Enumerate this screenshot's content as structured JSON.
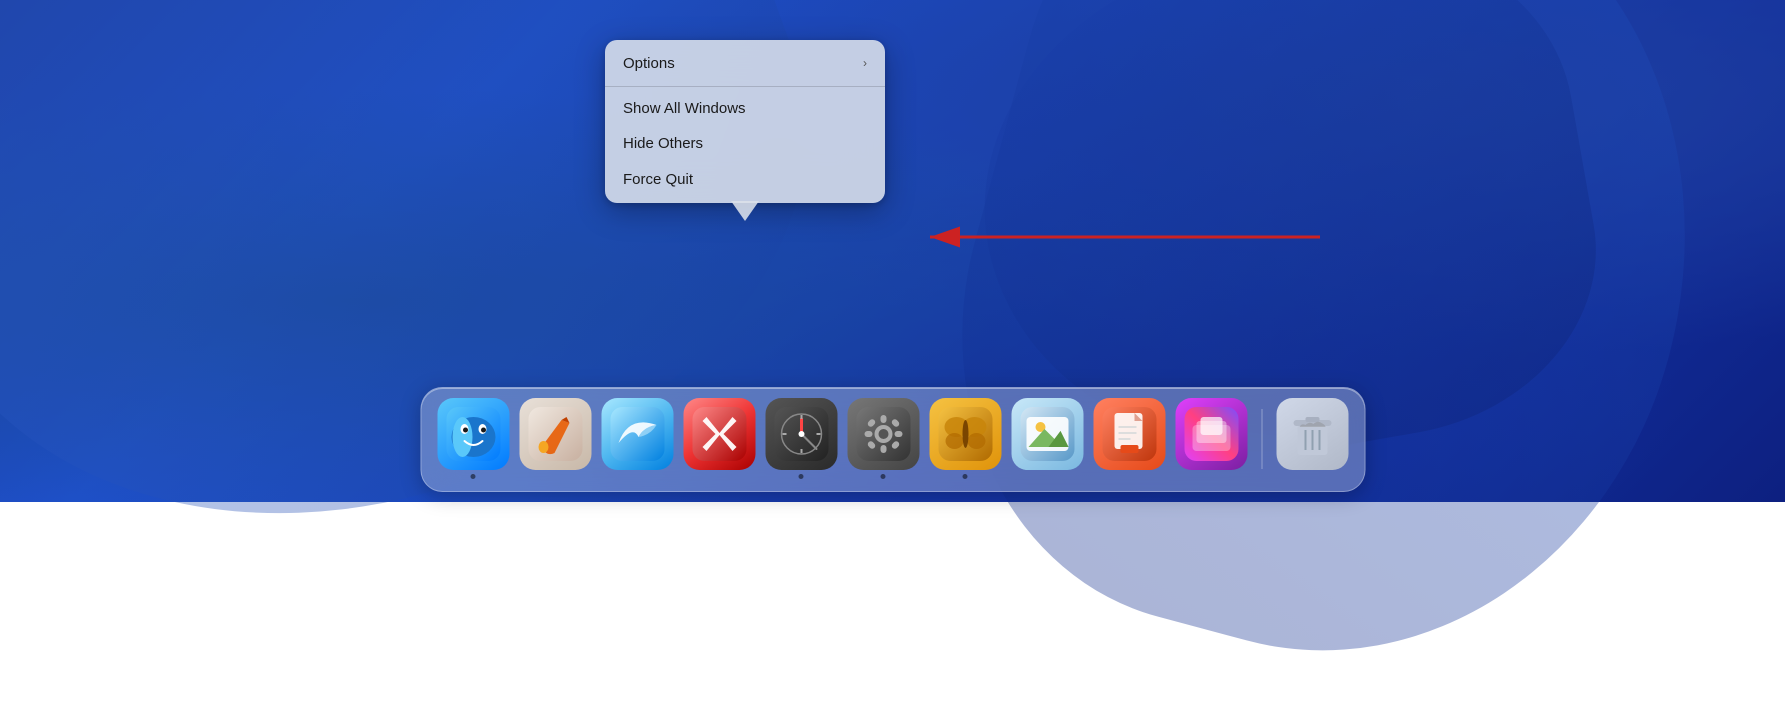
{
  "desktop": {
    "background": "macOS Ventura blue wallpaper"
  },
  "context_menu": {
    "items": [
      {
        "id": "options",
        "label": "Options",
        "has_submenu": true,
        "separator_after": true
      },
      {
        "id": "show_all_windows",
        "label": "Show All Windows",
        "has_submenu": false,
        "separator_after": false
      },
      {
        "id": "hide_others",
        "label": "Hide Others",
        "has_submenu": false,
        "separator_after": false
      },
      {
        "id": "force_quit",
        "label": "Force Quit",
        "has_submenu": false,
        "separator_after": false
      }
    ]
  },
  "annotation": {
    "arrow_label": "Force Quit arrow annotation"
  },
  "dock": {
    "items": [
      {
        "id": "finder",
        "label": "Finder",
        "running": true
      },
      {
        "id": "pixelmator",
        "label": "Pixelmator Pro",
        "running": false
      },
      {
        "id": "migrate",
        "label": "Migration Assistant",
        "running": false
      },
      {
        "id": "simulator",
        "label": "Simulator",
        "running": false
      },
      {
        "id": "safari",
        "label": "Safari",
        "running": true
      },
      {
        "id": "system-prefs",
        "label": "System Preferences",
        "running": true
      },
      {
        "id": "tes",
        "label": "Tes",
        "running": true
      },
      {
        "id": "preview",
        "label": "Preview",
        "running": false
      },
      {
        "id": "toolbox",
        "label": "Toolbox",
        "running": false
      },
      {
        "id": "screens",
        "label": "Screens",
        "running": false
      }
    ],
    "trash": {
      "label": "Trash",
      "running": false
    }
  }
}
